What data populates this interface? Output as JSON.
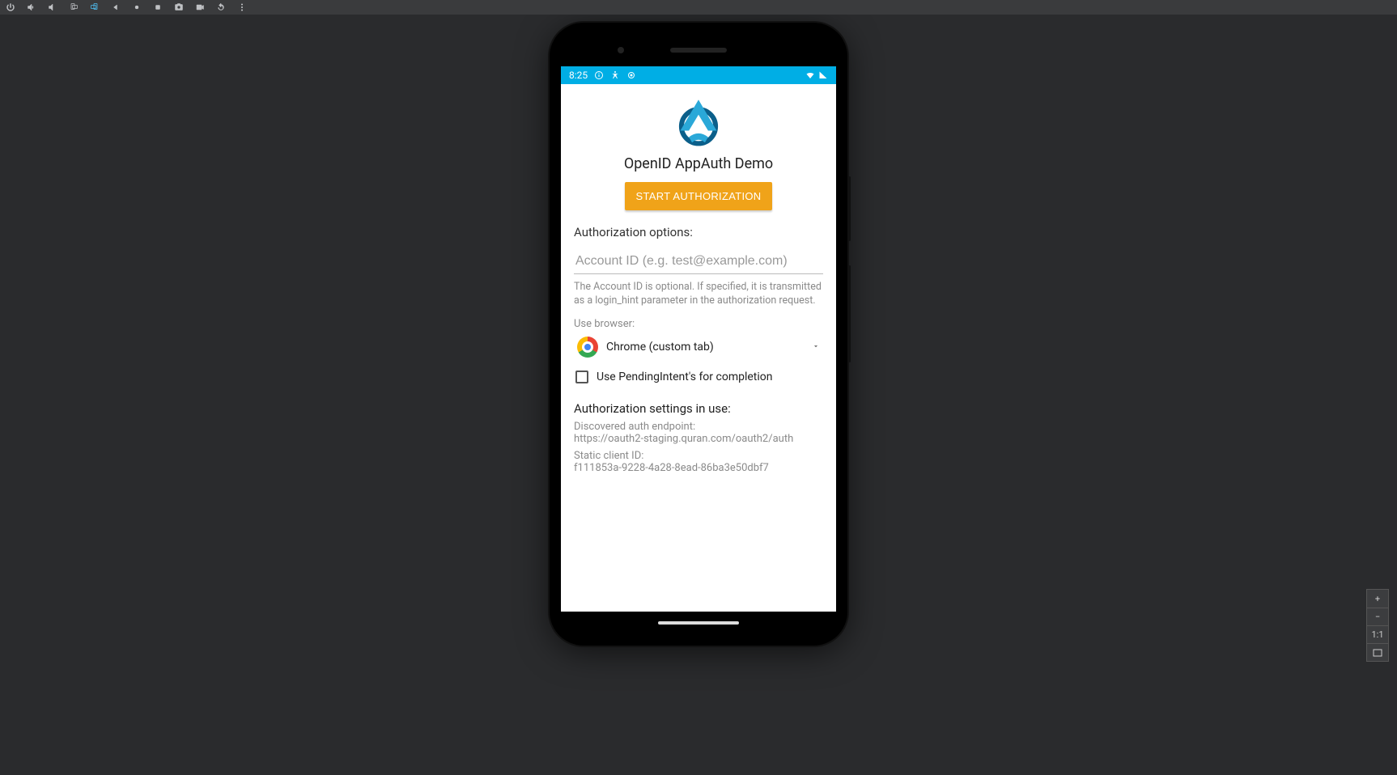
{
  "statusbar": {
    "time": "8:25"
  },
  "app": {
    "title": "OpenID AppAuth Demo",
    "start_button": "START AUTHORIZATION",
    "options_label": "Authorization options:",
    "account_placeholder": "Account ID (e.g. test@example.com)",
    "account_helper": "The Account ID is optional. If specified, it is transmitted as a login_hint parameter in the authorization request.",
    "browser_label": "Use browser:",
    "browser_value": "Chrome (custom tab)",
    "pending_intent_label": "Use PendingIntent's for completion",
    "settings_label": "Authorization settings in use:",
    "endpoint_label": "Discovered auth endpoint:",
    "endpoint_value": "https://oauth2-staging.quran.com/oauth2/auth",
    "client_id_label": "Static client ID:",
    "client_id_value": "f111853a-9228-4a28-8ead-86ba3e50dbf7"
  },
  "zoom": {
    "plus": "+",
    "minus": "−",
    "one_to_one": "1:1"
  }
}
